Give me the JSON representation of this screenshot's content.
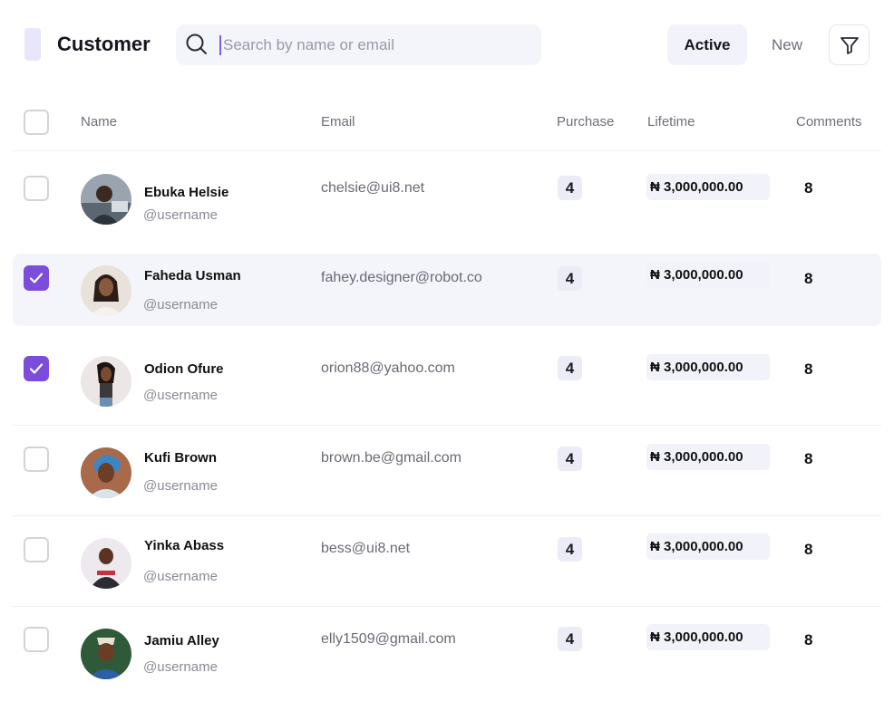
{
  "header": {
    "title": "Customer",
    "search_placeholder": "Search by name or email",
    "search_value": "",
    "tabs": [
      {
        "label": "Active",
        "active": true
      },
      {
        "label": "New",
        "active": false
      }
    ]
  },
  "columns": [
    "Name",
    "Email",
    "Purchase",
    "Lifetime",
    "Comments"
  ],
  "rows": [
    {
      "name": "Ebuka Helsie",
      "handle": "@username",
      "email": "chelsie@ui8.net",
      "purchase": "4",
      "lifetime": "₦ 3,000,000.00",
      "comments": "8",
      "checked": false
    },
    {
      "name": "Faheda Usman",
      "handle": "@username",
      "email": "fahey.designer@robot.co",
      "purchase": "4",
      "lifetime": "₦ 3,000,000.00",
      "comments": "8",
      "checked": true
    },
    {
      "name": "Odion Ofure",
      "handle": "@username",
      "email": "orion88@yahoo.com",
      "purchase": "4",
      "lifetime": "₦ 3,000,000.00",
      "comments": "8",
      "checked": true
    },
    {
      "name": "Kufi Brown",
      "handle": "@username",
      "email": "brown.be@gmail.com",
      "purchase": "4",
      "lifetime": "₦ 3,000,000.00",
      "comments": "8",
      "checked": false
    },
    {
      "name": "Yinka Abass",
      "handle": "@username",
      "email": "bess@ui8.net",
      "purchase": "4",
      "lifetime": "₦ 3,000,000.00",
      "comments": "8",
      "checked": false
    },
    {
      "name": "Jamiu Alley",
      "handle": "@username",
      "email": "elly1509@gmail.com",
      "purchase": "4",
      "lifetime": "₦ 3,000,000.00",
      "comments": "8",
      "checked": false
    }
  ],
  "colors": {
    "accent": "#7c4ddb",
    "selected_row": "#f4f4fb",
    "chip": "#ececf6"
  }
}
